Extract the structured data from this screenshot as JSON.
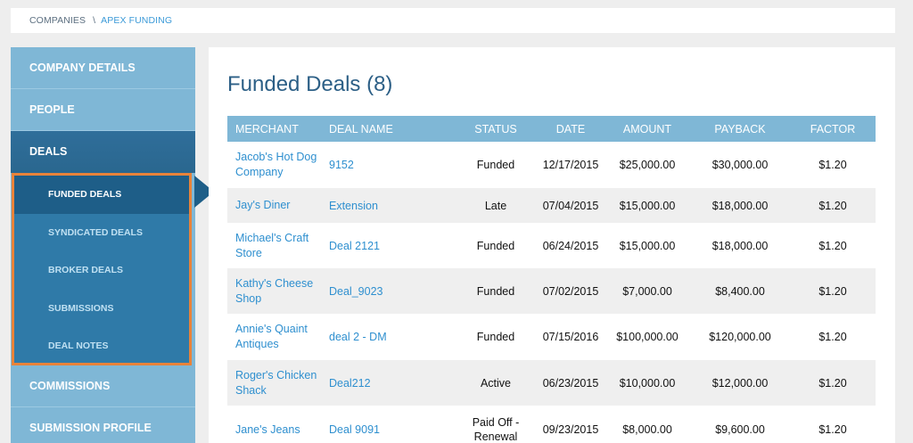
{
  "breadcrumb": {
    "items": [
      "COMPANIES",
      "APEX FUNDING"
    ],
    "separator": "\\"
  },
  "sidebar": {
    "items": [
      {
        "label": "COMPANY DETAILS"
      },
      {
        "label": "PEOPLE"
      },
      {
        "label": "DEALS"
      },
      {
        "label": "COMMISSIONS"
      },
      {
        "label": "SUBMISSION PROFILE"
      }
    ],
    "deals_submenu": [
      {
        "label": "FUNDED DEALS",
        "active": true
      },
      {
        "label": "SYNDICATED DEALS"
      },
      {
        "label": "BROKER DEALS"
      },
      {
        "label": "SUBMISSIONS"
      },
      {
        "label": "DEAL NOTES"
      }
    ]
  },
  "main": {
    "title": "Funded Deals (8)",
    "table": {
      "headers": [
        "MERCHANT",
        "DEAL NAME",
        "STATUS",
        "DATE",
        "AMOUNT",
        "PAYBACK",
        "FACTOR"
      ],
      "rows": [
        {
          "merchant_1": "Jacob's Hot Dog",
          "merchant_2": "Company",
          "deal": "9152",
          "status_1": "Funded",
          "status_2": "",
          "date": "12/17/2015",
          "amount": "$25,000.00",
          "payback": "$30,000.00",
          "factor": "$1.20"
        },
        {
          "merchant_1": "Jay's Diner",
          "merchant_2": "",
          "deal": "Extension",
          "status_1": "Late",
          "status_2": "",
          "date": "07/04/2015",
          "amount": "$15,000.00",
          "payback": "$18,000.00",
          "factor": "$1.20"
        },
        {
          "merchant_1": "Michael's Craft",
          "merchant_2": "Store",
          "deal": "Deal 2121",
          "status_1": "Funded",
          "status_2": "",
          "date": "06/24/2015",
          "amount": "$15,000.00",
          "payback": "$18,000.00",
          "factor": "$1.20"
        },
        {
          "merchant_1": "Kathy's Cheese",
          "merchant_2": "Shop",
          "deal": "Deal_9023",
          "status_1": "Funded",
          "status_2": "",
          "date": "07/02/2015",
          "amount": "$7,000.00",
          "payback": "$8,400.00",
          "factor": "$1.20"
        },
        {
          "merchant_1": "Annie's Quaint",
          "merchant_2": "Antiques",
          "deal": "deal 2 - DM",
          "status_1": "Funded",
          "status_2": "",
          "date": "07/15/2016",
          "amount": "$100,000.00",
          "payback": "$120,000.00",
          "factor": "$1.20"
        },
        {
          "merchant_1": "Roger's Chicken",
          "merchant_2": "Shack",
          "deal": "Deal212",
          "status_1": "Active",
          "status_2": "",
          "date": "06/23/2015",
          "amount": "$10,000.00",
          "payback": "$12,000.00",
          "factor": "$1.20"
        },
        {
          "merchant_1": "Jane's Jeans",
          "merchant_2": "",
          "deal": "Deal 9091",
          "status_1": "Paid Off -",
          "status_2": "Renewal",
          "date": "09/23/2015",
          "amount": "$8,000.00",
          "payback": "$9,600.00",
          "factor": "$1.20"
        }
      ]
    }
  }
}
